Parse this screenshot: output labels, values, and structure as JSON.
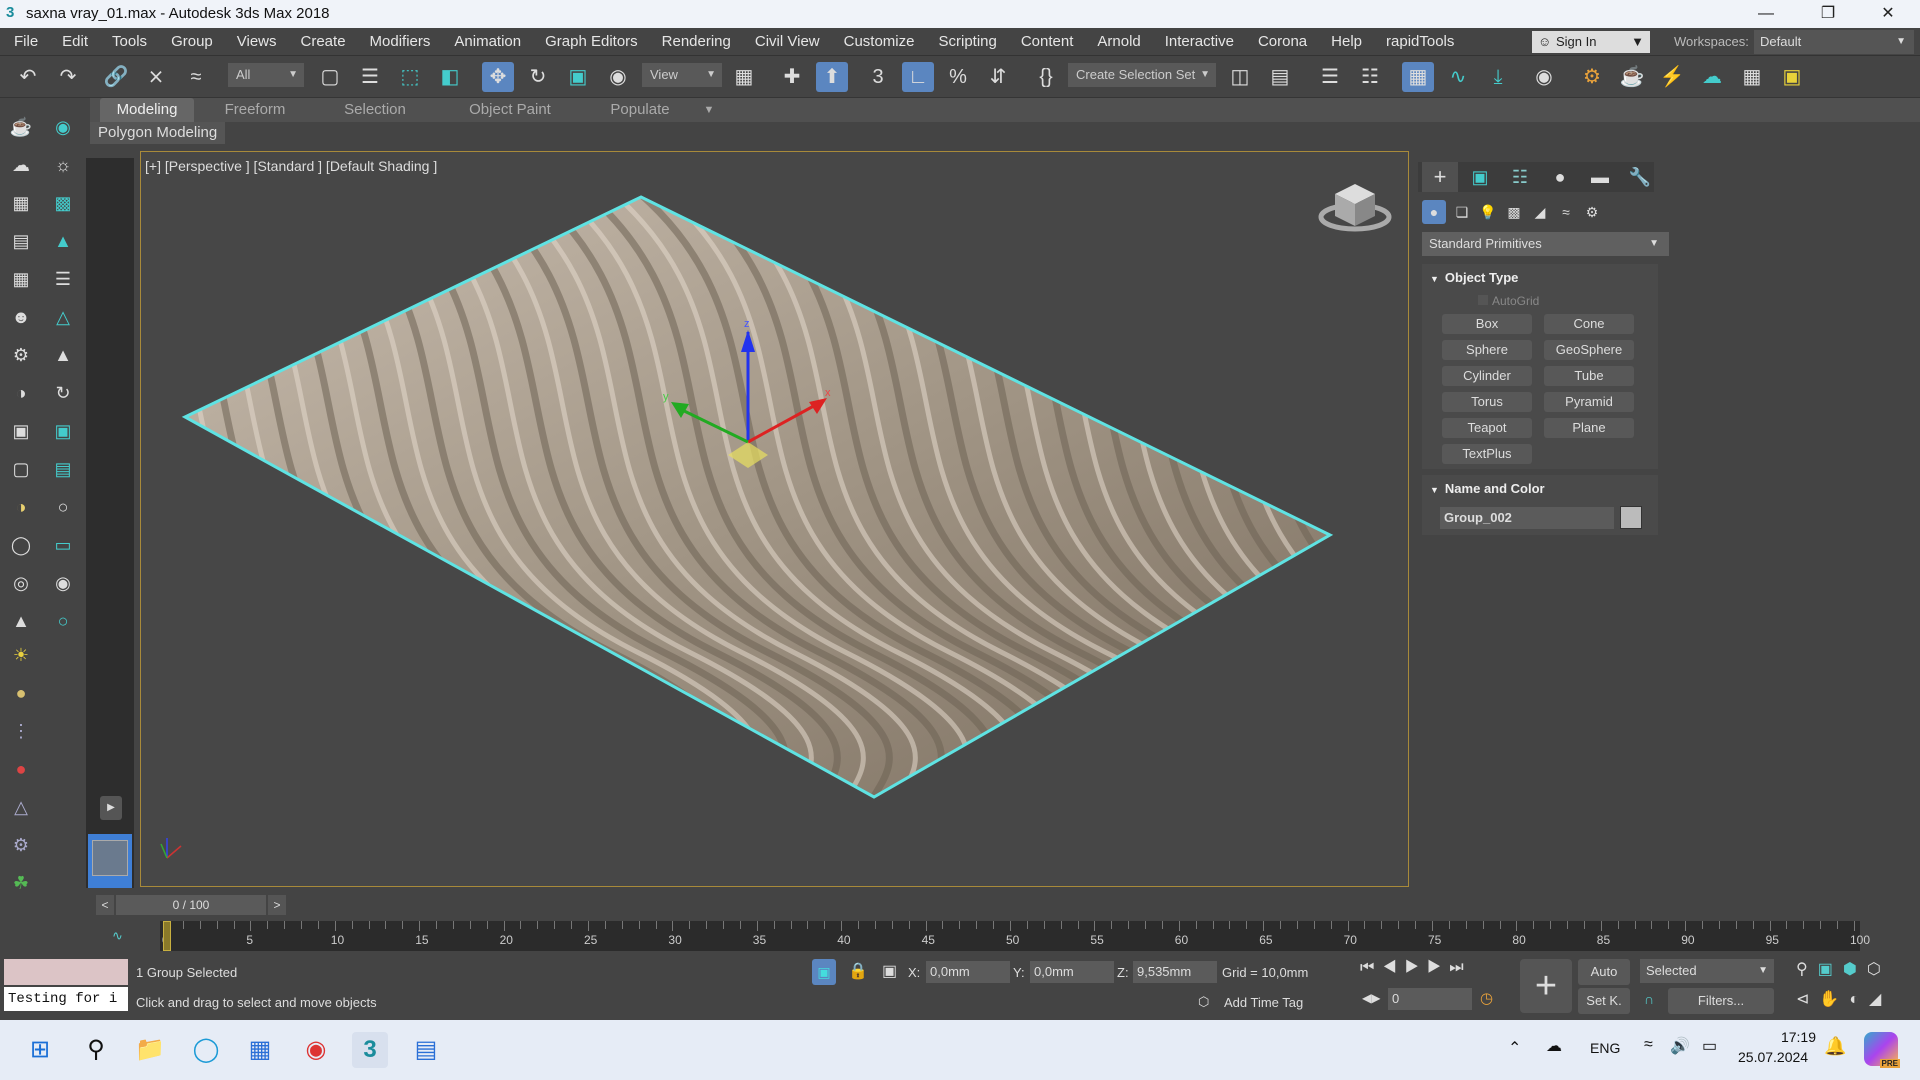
{
  "window": {
    "title": "saxna vray_01.max - Autodesk 3ds Max 2018",
    "app_icon": "3"
  },
  "menu": [
    "File",
    "Edit",
    "Tools",
    "Group",
    "Views",
    "Create",
    "Modifiers",
    "Animation",
    "Graph Editors",
    "Rendering",
    "Civil View",
    "Customize",
    "Scripting",
    "Content",
    "Arnold",
    "Interactive",
    "Corona",
    "Help",
    "rapidTools"
  ],
  "account": {
    "sign_in": "Sign In",
    "workspaces_label": "Workspaces:",
    "workspace": "Default"
  },
  "toolbar": {
    "filter": "All",
    "ref_coord": "View",
    "selection_set": "Create Selection Set",
    "snap_label": "3"
  },
  "ribbon": {
    "tabs": [
      "Modeling",
      "Freeform",
      "Selection",
      "Object Paint",
      "Populate"
    ],
    "sub": "Polygon Modeling"
  },
  "viewport": {
    "label": "[+] [Perspective ] [Standard ] [Default Shading ]",
    "accent": "#5fe3e3"
  },
  "command_panel": {
    "category": "Standard Primitives",
    "object_type_title": "Object Type",
    "autogrid": "AutoGrid",
    "buttons": [
      "Box",
      "Cone",
      "Sphere",
      "GeoSphere",
      "Cylinder",
      "Tube",
      "Torus",
      "Pyramid",
      "Teapot",
      "Plane",
      "TextPlus"
    ],
    "name_color_title": "Name and Color",
    "name": "Group_002"
  },
  "timeline": {
    "slider": "0 / 100",
    "labels": [
      "0",
      "5",
      "10",
      "15",
      "20",
      "25",
      "30",
      "35",
      "40",
      "45",
      "50",
      "55",
      "60",
      "65",
      "70",
      "75",
      "80",
      "85",
      "90",
      "95",
      "100"
    ]
  },
  "status": {
    "maxscript": "Testing for i",
    "selection": "1 Group Selected",
    "prompt": "Click and drag to select and move objects",
    "x_label": "X:",
    "x": "0,0mm",
    "y_label": "Y:",
    "y": "0,0mm",
    "z_label": "Z:",
    "z": "9,535mm",
    "grid": "Grid = 10,0mm",
    "add_time_tag": "Add Time Tag",
    "frame": "0",
    "auto": "Auto",
    "setk": "Set K.",
    "key_filter": "Selected",
    "filters": "Filters..."
  },
  "taskbar": {
    "lang": "ENG",
    "time": "17:19",
    "date": "25.07.2024",
    "badge": "PRE"
  }
}
